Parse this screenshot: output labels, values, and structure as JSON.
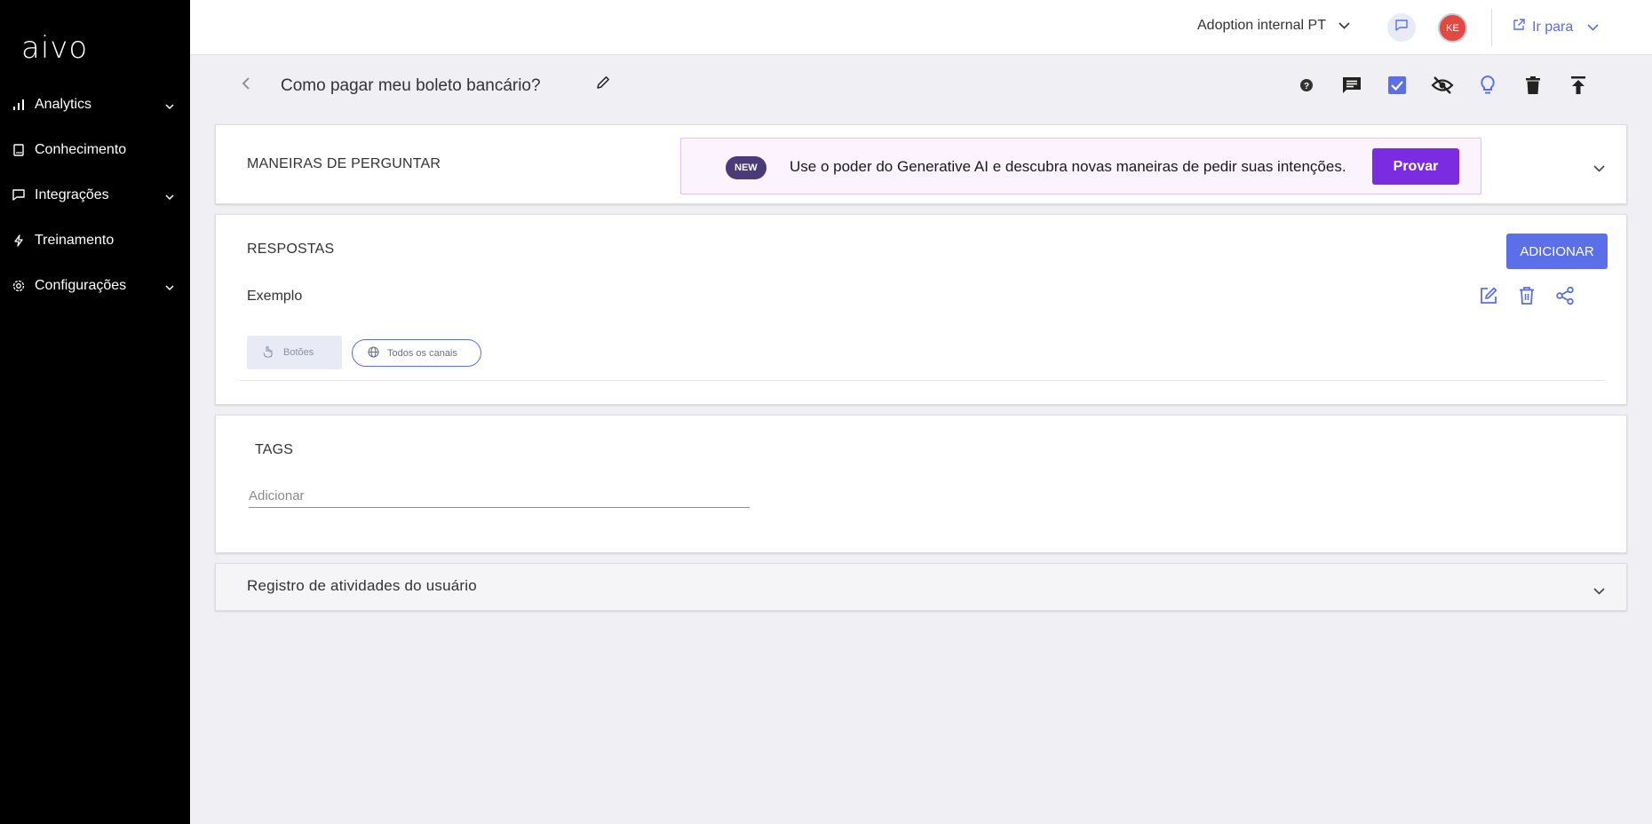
{
  "app": {
    "logo": "aivo"
  },
  "sidebar": {
    "items": [
      {
        "label": "Analytics",
        "icon": "bar-chart-icon",
        "has_chevron": true
      },
      {
        "label": "Conhecimento",
        "icon": "book-icon",
        "has_chevron": false
      },
      {
        "label": "Integrações",
        "icon": "chat-bubble-icon",
        "has_chevron": true
      },
      {
        "label": "Treinamento",
        "icon": "bolt-icon",
        "has_chevron": false
      },
      {
        "label": "Configurações",
        "icon": "gear-icon",
        "has_chevron": true
      }
    ]
  },
  "topbar": {
    "workspace": "Adoption internal PT",
    "avatar_initials": "KE",
    "goto_label": "Ir para"
  },
  "titlebar": {
    "title": "Como pagar meu boleto bancário?",
    "actions": [
      "help-icon",
      "comment-icon",
      "checkbox-icon",
      "visibility-off-icon",
      "lightbulb-icon",
      "trash-icon",
      "publish-icon"
    ]
  },
  "ways_to_ask": {
    "title": "MANEIRAS DE PERGUNTAR",
    "badge": "NEW",
    "banner_text": "Use o poder do Generative AI e descubra novas maneiras de pedir suas intenções.",
    "try_button": "Provar"
  },
  "answers": {
    "title": "RESPOSTAS",
    "add_button": "ADICIONAR",
    "items": [
      {
        "label": "Exemplo",
        "chip_type": "Botões",
        "chip_channel": "Todos os canais"
      }
    ]
  },
  "tags": {
    "title": "TAGS",
    "placeholder": "Adicionar"
  },
  "activity_log": {
    "title": "Registro de atividades do usuário"
  },
  "colors": {
    "sidebar_bg": "#000000",
    "accent": "#5a6fe8",
    "try_button": "#7b2ce0",
    "avatar": "#e04a43",
    "badge_new": "#4a3a78"
  }
}
